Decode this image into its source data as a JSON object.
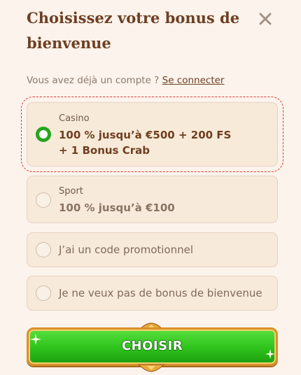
{
  "header": {
    "title_line1": "Choisissez votre bonus de",
    "title_line2": "bienvenue",
    "close_icon": "close-icon"
  },
  "login": {
    "prompt": "Vous avez déjà un compte ?",
    "link_label": "Se connecter"
  },
  "options": [
    {
      "subtitle": "Casino",
      "line1": "100 % jusqu’à €500 + 200 FS",
      "line2": "+ 1 Bonus Crab",
      "selected": true
    },
    {
      "subtitle": "Sport",
      "line1": "100 % jusqu’à €100",
      "selected": false
    },
    {
      "label": "J’ai un code promotionnel",
      "selected": false
    },
    {
      "label": "Je ne veux pas de bonus de bienvenue",
      "selected": false
    }
  ],
  "cta": {
    "label": "CHOISIR"
  },
  "colors": {
    "background": "#fbf3ec",
    "title": "#6e3f22",
    "option_bg": "#f8eadb",
    "radio_selected": "#26a51f",
    "cta_green": "#2ec21b",
    "cta_gold": "#d9912a",
    "highlight": "#e3342f"
  }
}
